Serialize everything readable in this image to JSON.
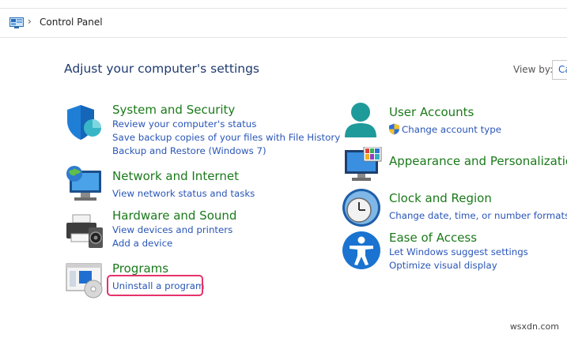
{
  "breadcrumb": {
    "location": "Control Panel",
    "separator": "›"
  },
  "header": {
    "title": "Adjust your computer's settings",
    "view_by_label": "View by:",
    "view_by_value": "Ca"
  },
  "categories_left": [
    {
      "title": "System and Security",
      "links": [
        "Review your computer's status",
        "Save backup copies of your files with File History",
        "Backup and Restore (Windows 7)"
      ]
    },
    {
      "title": "Network and Internet",
      "links": [
        "View network status and tasks"
      ]
    },
    {
      "title": "Hardware and Sound",
      "links": [
        "View devices and printers",
        "Add a device"
      ]
    },
    {
      "title": "Programs",
      "links": [
        "Uninstall a program"
      ]
    }
  ],
  "categories_right": [
    {
      "title": "User Accounts",
      "links": [
        "Change account type"
      ]
    },
    {
      "title": "Appearance and Personalization",
      "links": []
    },
    {
      "title": "Clock and Region",
      "links": [
        "Change date, time, or number formats"
      ]
    },
    {
      "title": "Ease of Access",
      "links": [
        "Let Windows suggest settings",
        "Optimize visual display"
      ]
    }
  ],
  "watermark": "wsxdn.com"
}
